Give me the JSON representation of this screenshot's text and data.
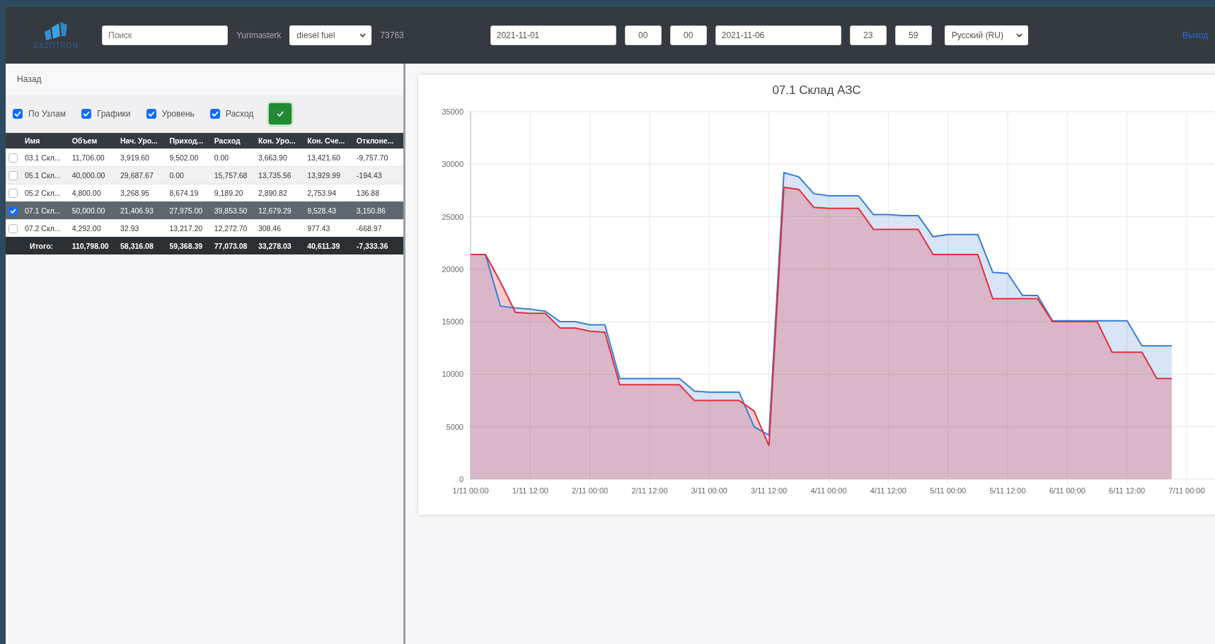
{
  "header": {
    "brand": "EXZOTRON",
    "search": {
      "placeholder": "Поиск"
    },
    "user": "Yurimasterk",
    "fuel": "diesel fuel",
    "code": "73763",
    "date_from": "2021-11-01",
    "hour_from": "00",
    "minute_from": "00",
    "date_to": "2021-11-06",
    "hour_to": "23",
    "minute_to": "59",
    "language": "Русский (RU)",
    "logout": "Выход"
  },
  "back": "Назад",
  "filters": [
    {
      "label": "По Узлам",
      "checked": true
    },
    {
      "label": "Графики",
      "checked": true
    },
    {
      "label": "Уровень",
      "checked": true
    },
    {
      "label": "Расход",
      "checked": true
    }
  ],
  "table": {
    "columns": [
      "Имя",
      "Объем",
      "Нач. Уро...",
      "Приход...",
      "Расход",
      "Кон. Уро...",
      "Кон. Сче...",
      "Отклоне..."
    ],
    "rows": [
      {
        "selected": false,
        "cells": [
          "03.1 Скл...",
          "11,706.00",
          "3,919.60",
          "9,502.00",
          "0.00",
          "3,663.90",
          "13,421.60",
          "-9,757.70"
        ]
      },
      {
        "selected": false,
        "cells": [
          "05.1 Скл...",
          "40,000.00",
          "29,687.67",
          "0.00",
          "15,757.68",
          "13,735.56",
          "13,929.99",
          "-194.43"
        ]
      },
      {
        "selected": false,
        "cells": [
          "05.2 Скл...",
          "4,800.00",
          "3,268.95",
          "8,674.19",
          "9,189.20",
          "2,890.82",
          "2,753.94",
          "136.88"
        ]
      },
      {
        "selected": true,
        "cells": [
          "07.1 Скл...",
          "50,000.00",
          "21,406.93",
          "27,975.00",
          "39,853.50",
          "12,679.29",
          "9,528.43",
          "3,150.86"
        ]
      },
      {
        "selected": false,
        "cells": [
          "07.2 Скл...",
          "4,292.00",
          "32.93",
          "13,217.20",
          "12,272.70",
          "308.46",
          "977.43",
          "-668.97"
        ]
      }
    ],
    "total": [
      "Итого:",
      "110,798.00",
      "58,316.08",
      "59,368.39",
      "77,073.08",
      "33,278.03",
      "40,611.39",
      "-7,333.36"
    ]
  },
  "chart": {
    "chart_data": {
      "type": "area",
      "title": "07.1 Склад АЗС",
      "grid": true,
      "ylim": [
        0,
        35000
      ],
      "categories": [
        "1/11 00:00",
        null,
        null,
        null,
        "1/11 12:00",
        null,
        null,
        null,
        "2/11 00:00",
        null,
        null,
        null,
        "2/11 12:00",
        null,
        null,
        null,
        "3/11 00:00",
        null,
        null,
        null,
        "3/11 12:00",
        null,
        null,
        null,
        "4/11 00:00",
        null,
        null,
        null,
        "4/11 12:00",
        null,
        null,
        null,
        "5/11 00:00",
        null,
        null,
        null,
        "5/11 12:00",
        null,
        null,
        null,
        "6/11 00:00",
        null,
        null,
        null,
        "6/11 12:00",
        null,
        null,
        null,
        "7/11 00:00"
      ],
      "yticks": [
        0,
        5000,
        10000,
        15000,
        20000,
        25000,
        30000,
        35000
      ],
      "series": [
        {
          "color": "#3a7dd6",
          "values": [
            21400,
            21400,
            16500,
            16300,
            16200,
            16000,
            15000,
            15000,
            14700,
            14700,
            9600,
            9600,
            9600,
            9600,
            9600,
            8400,
            8300,
            8300,
            8300,
            5000,
            4200,
            29200,
            28800,
            27200,
            27000,
            27000,
            27000,
            25200,
            25200,
            25100,
            25100,
            23100,
            23300,
            23300,
            23300,
            19700,
            19600,
            17500,
            17500,
            15100,
            15100,
            15100,
            15100,
            15100,
            15100,
            12700,
            12700,
            12700,
            null
          ]
        },
        {
          "color": "#e0303c",
          "values": [
            21400,
            21400,
            18800,
            15900,
            15800,
            15800,
            14400,
            14400,
            14100,
            14000,
            9000,
            9000,
            9000,
            9000,
            9000,
            7500,
            7500,
            7500,
            7500,
            6500,
            3200,
            27800,
            27600,
            25900,
            25800,
            25800,
            25800,
            23800,
            23800,
            23800,
            23800,
            21400,
            21400,
            21400,
            21400,
            17200,
            17200,
            17200,
            17200,
            15000,
            15000,
            15000,
            15000,
            12100,
            12100,
            12100,
            9600,
            9600,
            null
          ]
        }
      ]
    }
  }
}
